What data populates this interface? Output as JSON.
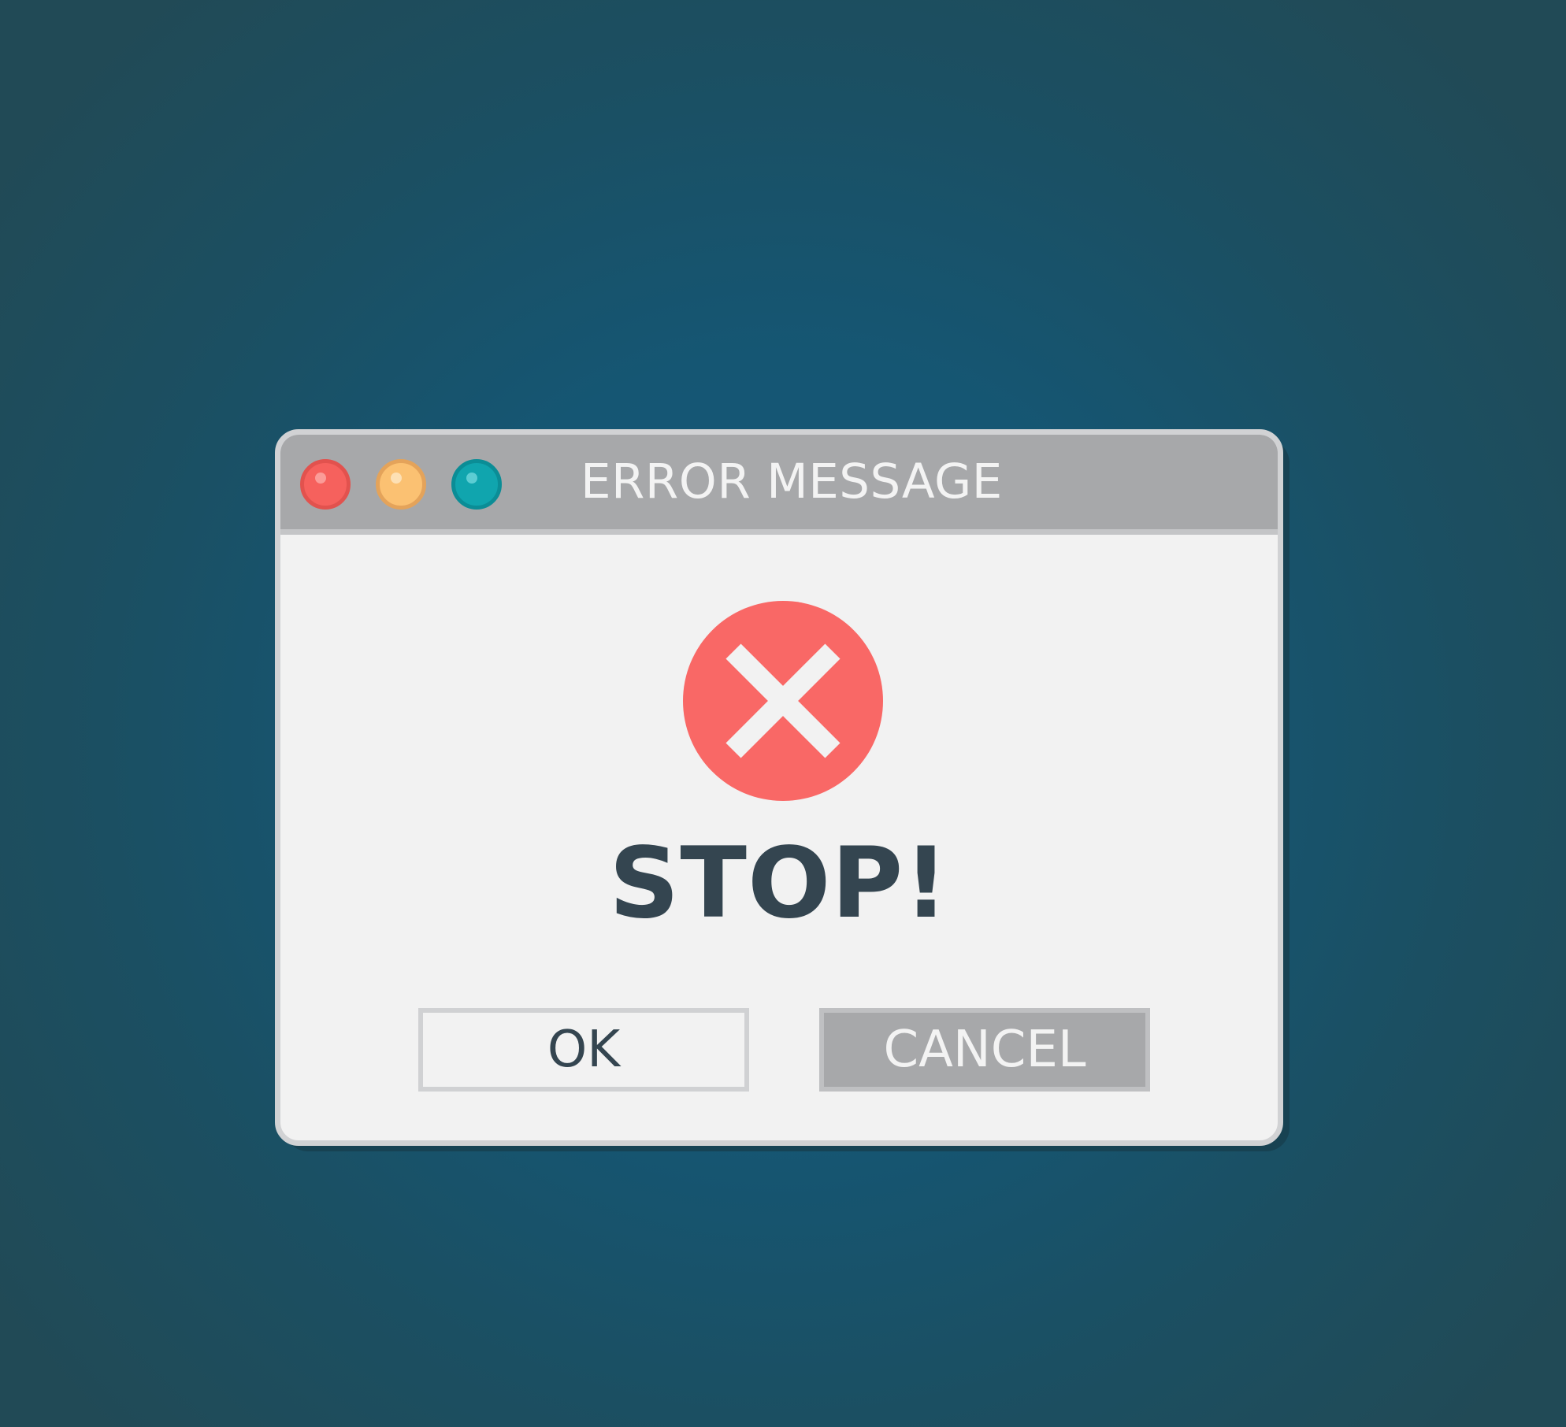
{
  "dialog": {
    "title": "ERROR MESSAGE",
    "message": "STOP!",
    "icon": "error-x-icon",
    "window_controls": [
      {
        "name": "close",
        "color": "#f6615d"
      },
      {
        "name": "minimize",
        "color": "#fbc172"
      },
      {
        "name": "maximize",
        "color": "#10a5ae"
      }
    ],
    "buttons": {
      "ok_label": "OK",
      "cancel_label": "CANCEL"
    }
  },
  "colors": {
    "background": "#155673",
    "titlebar": "#a7a8aa",
    "dialog_body": "#f2f2f2",
    "error_red": "#f96866",
    "message_text": "#344550"
  }
}
